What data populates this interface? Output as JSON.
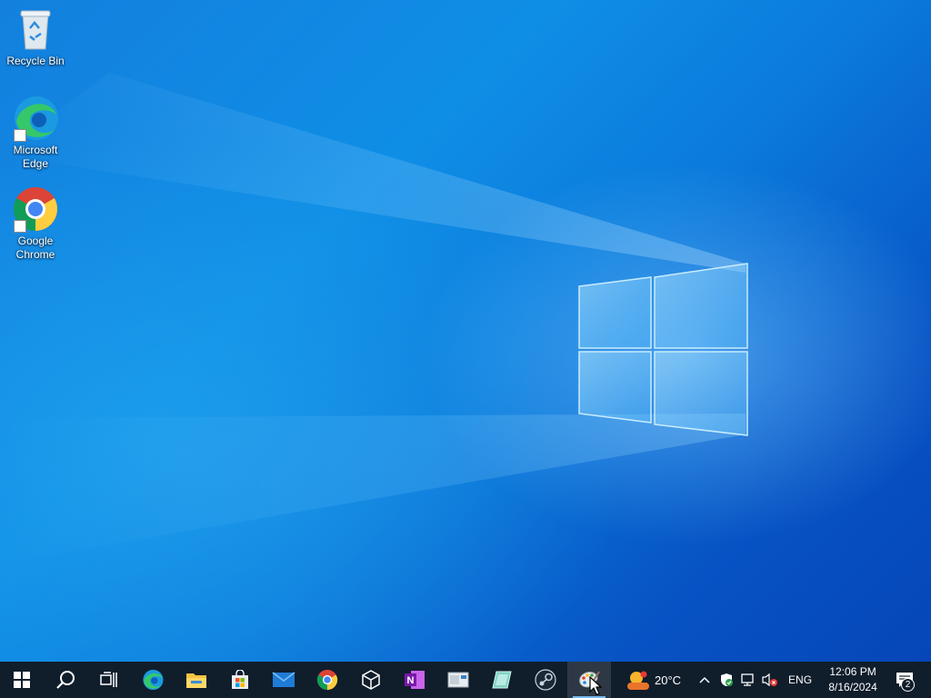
{
  "desktop": {
    "icons": [
      {
        "label": "Recycle Bin",
        "icon": "recycle-bin-icon"
      },
      {
        "label": "Microsoft Edge",
        "icon": "edge-icon"
      },
      {
        "label": "Google Chrome",
        "icon": "chrome-icon"
      }
    ]
  },
  "taskbar": {
    "items": [
      {
        "name": "Start",
        "icon": "windows-start-icon"
      },
      {
        "name": "Search",
        "icon": "search-icon"
      },
      {
        "name": "Task View",
        "icon": "task-view-icon"
      },
      {
        "name": "Microsoft Edge",
        "icon": "edge-icon"
      },
      {
        "name": "File Explorer",
        "icon": "folder-icon"
      },
      {
        "name": "Microsoft Store",
        "icon": "store-icon"
      },
      {
        "name": "Mail",
        "icon": "mail-icon"
      },
      {
        "name": "Google Chrome",
        "icon": "chrome-icon"
      },
      {
        "name": "3D Viewer",
        "icon": "cube-icon"
      },
      {
        "name": "OneNote",
        "icon": "onenote-icon"
      },
      {
        "name": "App",
        "icon": "window-app-icon"
      },
      {
        "name": "App",
        "icon": "tilted-card-icon"
      },
      {
        "name": "Steam",
        "icon": "steam-icon"
      },
      {
        "name": "Paint",
        "icon": "paint-palette-icon"
      }
    ],
    "weather": {
      "temp": "20°C",
      "icon": "weather-sun-cloud-icon"
    },
    "tray": {
      "icons": [
        "chevron-up-icon",
        "security-shield-icon",
        "network-icon",
        "volume-muted-icon"
      ],
      "language": "ENG",
      "time": "12:06 PM",
      "date": "8/16/2024",
      "notifications": "2"
    }
  },
  "colors": {
    "taskbar": "#101d2b",
    "accent": "#76b9ed",
    "wallpaper": "#0a6fd8"
  }
}
